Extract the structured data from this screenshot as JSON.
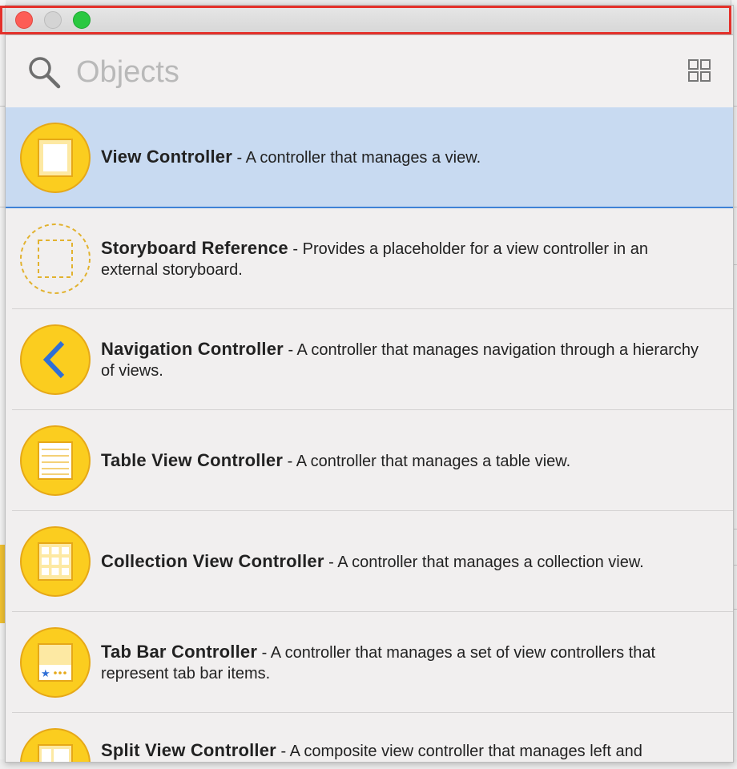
{
  "window": {
    "traffic_lights": [
      "close",
      "minimize",
      "zoom"
    ]
  },
  "search": {
    "placeholder": "Objects",
    "value": ""
  },
  "toolbar": {
    "view_toggle_icon": "grid-view-icon"
  },
  "objects": [
    {
      "title": "View Controller",
      "description": " - A controller that manages a view.",
      "icon": "view-controller-icon",
      "selected": true
    },
    {
      "title": "Storyboard Reference",
      "description": " - Provides a placeholder for a view controller in an external storyboard.",
      "icon": "storyboard-reference-icon"
    },
    {
      "title": "Navigation Controller",
      "description": " - A controller that manages navigation through a hierarchy of views.",
      "icon": "navigation-controller-icon"
    },
    {
      "title": "Table View Controller",
      "description": " - A controller that manages a table view.",
      "icon": "table-view-controller-icon"
    },
    {
      "title": "Collection View Controller",
      "description": " - A controller that manages a collection view.",
      "icon": "collection-view-controller-icon"
    },
    {
      "title": "Tab Bar Controller",
      "description": " - A controller that manages a set of view controllers that represent tab bar items.",
      "icon": "tab-bar-controller-icon"
    },
    {
      "title": "Split View Controller",
      "description": " - A composite view controller that manages left and",
      "icon": "split-view-controller-icon"
    }
  ],
  "colors": {
    "icon_fill": "#fbcd1f",
    "icon_border": "#e6a817",
    "selection": "#c8daf1",
    "selection_border": "#3f82d6",
    "nav_chevron": "#2f6fd6"
  }
}
